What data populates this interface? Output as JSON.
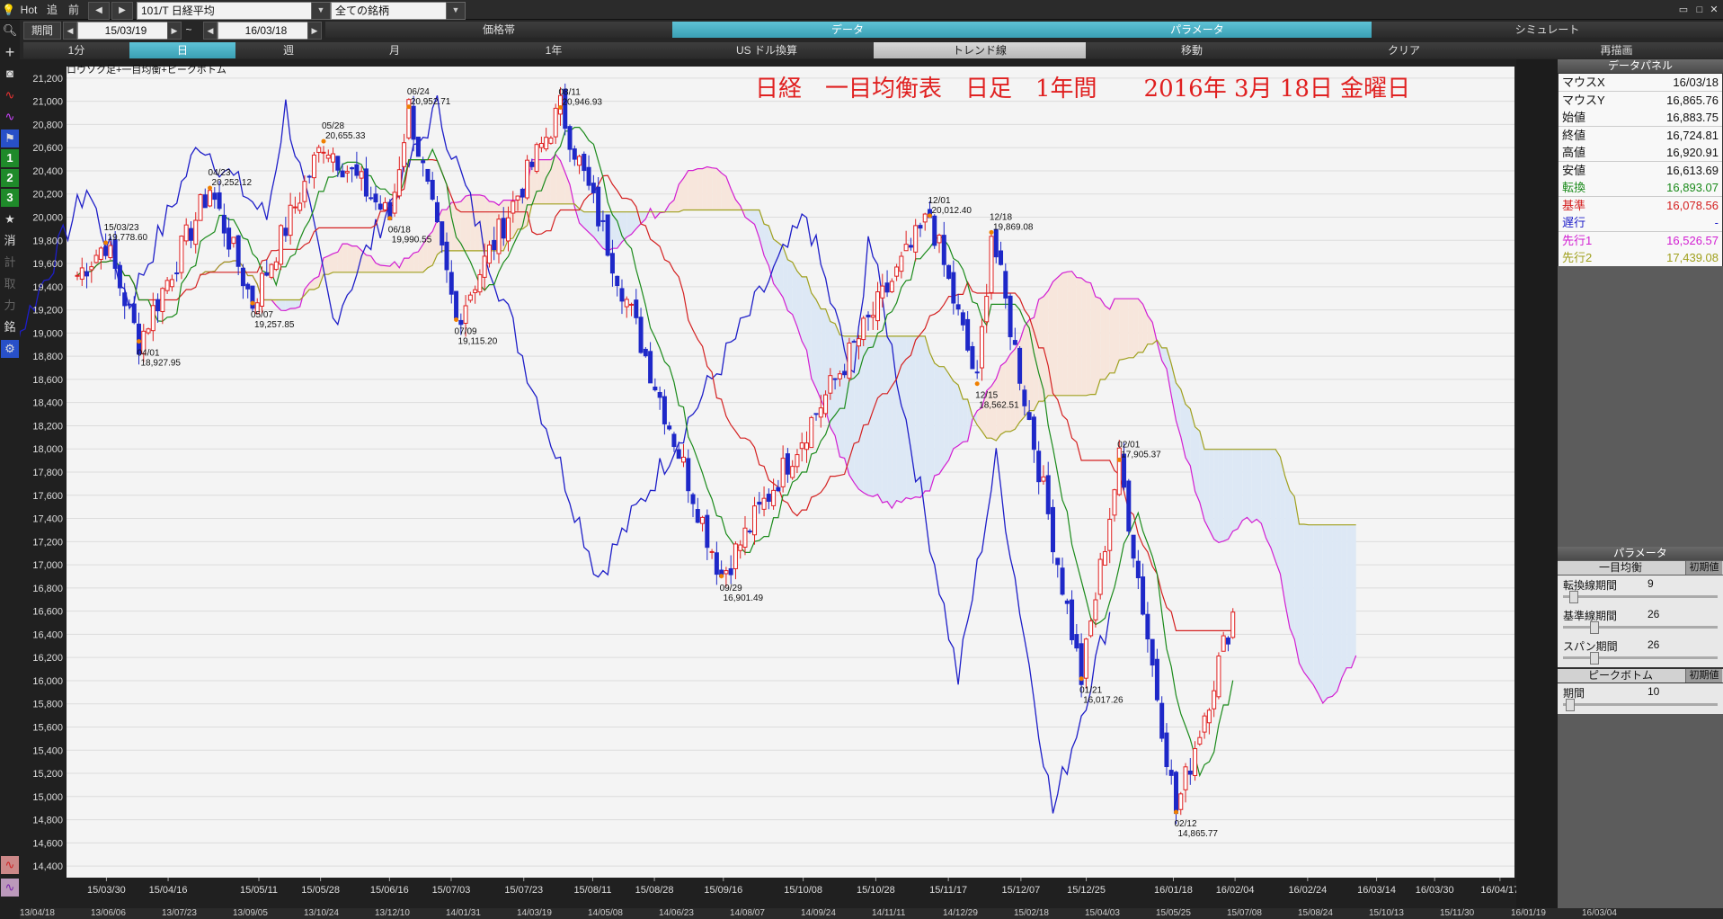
{
  "toolbar": {
    "hot": "Hot",
    "ato": "追",
    "mae": "前",
    "symbol": "101/T 日経平均",
    "universe": "全ての銘柄",
    "period_label": "期間",
    "date_from": "15/03/19",
    "tilde": "~",
    "date_to": "16/03/18",
    "tabs_top": [
      "価格帯",
      "データ",
      "パラメータ",
      "シミュレート"
    ],
    "tabs_bottom": [
      "1分",
      "日",
      "週",
      "月",
      "1年",
      "US ドル換算",
      "トレンド線",
      "移動",
      "クリア",
      "再描画"
    ]
  },
  "sidebar": {
    "numbers": [
      "1",
      "2",
      "3"
    ],
    "kanji": [
      "消",
      "計",
      "取",
      "力",
      "銘"
    ]
  },
  "chart": {
    "legend": "ロウソク足+一目均衡+ピークボトム",
    "title": "日経　一目均衡表　日足　1年間　　2016年 3月 18日 金曜日",
    "colors": {
      "tenkan": "#1a8a1a",
      "kijun": "#d42020",
      "chikou": "#1e1ec8",
      "senkou1": "#d21ed2",
      "senkou2": "#a0a01e",
      "kumo_up": "#f7e6dc",
      "kumo_down": "#dde8f5",
      "candle_up": "#e02020",
      "candle_down": "#1e28c8",
      "title": "#e02020"
    }
  },
  "chart_data": {
    "type": "candlestick",
    "title": "日経　一目均衡表　日足　1年間　　2016年 3月 18日 金曜日",
    "y_ticks": [
      "21,200",
      "21,000",
      "20,800",
      "20,600",
      "20,400",
      "20,200",
      "20,000",
      "19,800",
      "19,600",
      "19,400",
      "19,200",
      "19,000",
      "18,800",
      "18,600",
      "18,400",
      "18,200",
      "18,000",
      "17,800",
      "17,600",
      "17,400",
      "17,200",
      "17,000",
      "16,800",
      "16,600",
      "16,400",
      "16,200",
      "16,000",
      "15,800",
      "15,600",
      "15,400",
      "15,200",
      "15,000",
      "14,800",
      "14,600",
      "14,400"
    ],
    "ylim": [
      14300,
      21300
    ],
    "x_ticks": [
      "15/03/30",
      "15/04/16",
      "15/05/11",
      "15/05/28",
      "15/06/16",
      "15/07/03",
      "15/07/23",
      "15/08/11",
      "15/08/28",
      "15/09/16",
      "15/10/08",
      "15/10/28",
      "15/11/17",
      "15/12/07",
      "15/12/25",
      "16/01/18",
      "16/02/04",
      "16/02/24",
      "16/03/14",
      "16/03/30",
      "16/04/17"
    ],
    "x_range_dates": [
      "15/03/19",
      "16/04/21"
    ],
    "peaks": [
      {
        "date": "15/03/23",
        "value": "19,778.60",
        "kind": "peak"
      },
      {
        "date": "04/01",
        "value": "18,927.95",
        "kind": "bottom"
      },
      {
        "date": "04/23",
        "value": "20,252.12",
        "kind": "peak"
      },
      {
        "date": "05/07",
        "value": "19,257.85",
        "kind": "bottom"
      },
      {
        "date": "05/28",
        "value": "20,655.33",
        "kind": "peak"
      },
      {
        "date": "06/18",
        "value": "19,990.55",
        "kind": "bottom"
      },
      {
        "date": "06/24",
        "value": "20,952.71",
        "kind": "peak"
      },
      {
        "date": "07/09",
        "value": "19,115.20",
        "kind": "bottom"
      },
      {
        "date": "08/11",
        "value": "20,946.93",
        "kind": "peak"
      },
      {
        "date": "09/29",
        "value": "16,901.49",
        "kind": "bottom"
      },
      {
        "date": "12/01",
        "value": "20,012.40",
        "kind": "peak"
      },
      {
        "date": "12/18",
        "value": "19,869.08",
        "kind": "peak"
      },
      {
        "date": "12/15",
        "value": "18,562.51",
        "kind": "bottom"
      },
      {
        "date": "01/21",
        "value": "16,017.26",
        "kind": "bottom"
      },
      {
        "date": "02/01",
        "value": "17,905.37",
        "kind": "peak"
      },
      {
        "date": "02/12",
        "value": "14,865.77",
        "kind": "bottom"
      }
    ],
    "series_colors": {
      "tenkan": "#1a8a1a",
      "kijun": "#d42020",
      "chikou": "#1e1ec8",
      "senkou1": "#d21ed2",
      "senkou2": "#a0a01e"
    }
  },
  "data_panel": {
    "header": "データパネル",
    "rows": [
      {
        "k": "マウスX",
        "v": "16/03/18",
        "c": "#111"
      },
      {
        "k": "マウスY",
        "v": "16,865.76",
        "c": "#111"
      },
      {
        "k": "始値",
        "v": "16,883.75",
        "c": "#111"
      },
      {
        "k": "終値",
        "v": "16,724.81",
        "c": "#111"
      },
      {
        "k": "高値",
        "v": "16,920.91",
        "c": "#111"
      },
      {
        "k": "安値",
        "v": "16,613.69",
        "c": "#111"
      },
      {
        "k": "転換",
        "v": "16,893.07",
        "c": "#1a8a1a"
      },
      {
        "k": "基準",
        "v": "16,078.56",
        "c": "#d42020"
      },
      {
        "k": "遅行",
        "v": "-",
        "c": "#1e1ec8"
      },
      {
        "k": "先行1",
        "v": "16,526.57",
        "c": "#d21ed2"
      },
      {
        "k": "先行2",
        "v": "17,439.08",
        "c": "#a0a01e"
      }
    ]
  },
  "param_panel": {
    "header": "パラメータ",
    "ichimoku_title": "一目均衡",
    "reset_label": "初期値",
    "params": [
      {
        "label": "転換線期間",
        "value": "9",
        "pos": 0.04
      },
      {
        "label": "基準線期間",
        "value": "26",
        "pos": 0.18
      },
      {
        "label": "スパン期間",
        "value": "26",
        "pos": 0.18
      }
    ],
    "peak_title": "ピークボトム",
    "period_label": "期間",
    "period_value": "10",
    "period_pos": 0.02
  },
  "bottom_strip": [
    "13/04/18",
    "13/06/06",
    "13/07/23",
    "13/09/05",
    "13/10/24",
    "13/12/10",
    "14/01/31",
    "14/03/19",
    "14/05/08",
    "14/06/23",
    "14/08/07",
    "14/09/24",
    "14/11/11",
    "14/12/29",
    "15/02/18",
    "15/04/03",
    "15/05/25",
    "15/07/08",
    "15/08/24",
    "15/10/13",
    "15/11/30",
    "16/01/19",
    "16/03/04"
  ]
}
